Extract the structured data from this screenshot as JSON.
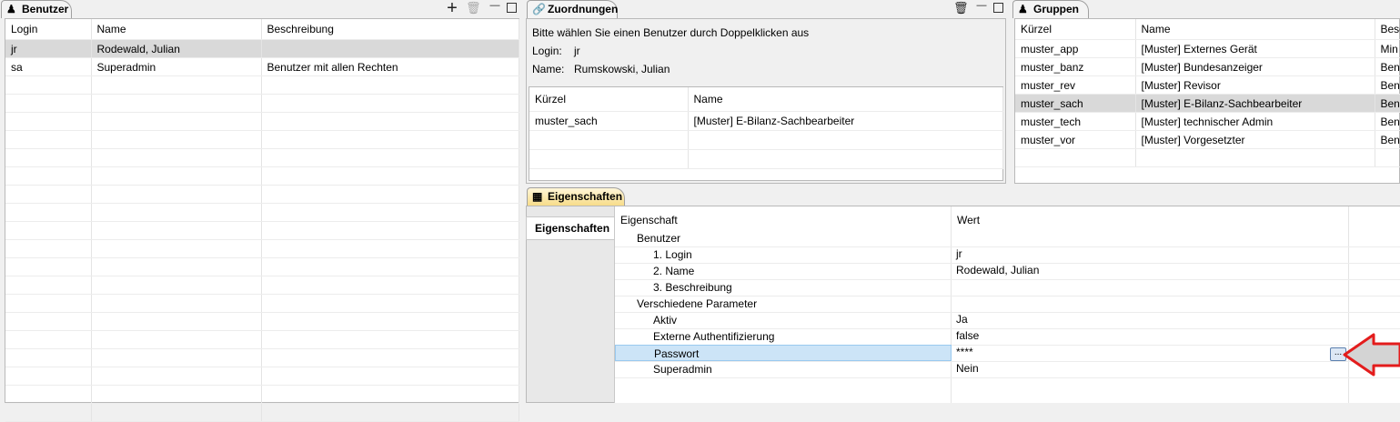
{
  "benutzer": {
    "tab_label": "Benutzer",
    "columns": [
      "Login",
      "Name",
      "Beschreibung"
    ],
    "rows": [
      {
        "login": "jr",
        "name": "Rodewald, Julian",
        "desc": ""
      },
      {
        "login": "sa",
        "name": "Superadmin",
        "desc": "Benutzer mit allen Rechten"
      }
    ]
  },
  "zuordnungen": {
    "tab_label": "Zuordnungen",
    "hint": "Bitte wählen Sie einen Benutzer durch Doppelklicken aus",
    "login_label": "Login:",
    "login_value": "jr",
    "name_label": "Name:",
    "name_value": "Rumskowski, Julian",
    "columns": [
      "Kürzel",
      "Name"
    ],
    "rows": [
      {
        "kuerzel": "muster_sach",
        "name": "[Muster] E-Bilanz-Sachbearbeiter"
      }
    ]
  },
  "gruppen": {
    "tab_label": "Gruppen",
    "columns": [
      "Kürzel",
      "Name",
      "Besc"
    ],
    "rows": [
      {
        "kuerzel": "muster_app",
        "name": "[Muster] Externes Gerät",
        "desc": "Min"
      },
      {
        "kuerzel": "muster_banz",
        "name": "[Muster] Bundesanzeiger",
        "desc": "Ben"
      },
      {
        "kuerzel": "muster_rev",
        "name": "[Muster] Revisor",
        "desc": "Ben"
      },
      {
        "kuerzel": "muster_sach",
        "name": "[Muster] E-Bilanz-Sachbearbeiter",
        "desc": "Ben"
      },
      {
        "kuerzel": "muster_tech",
        "name": "[Muster] technischer Admin",
        "desc": "Ben"
      },
      {
        "kuerzel": "muster_vor",
        "name": "[Muster] Vorgesetzter",
        "desc": "Ben"
      }
    ],
    "selected_index": 3
  },
  "eigenschaften": {
    "tab_label": "Eigenschaften",
    "side_tab_label": "Eigenschaften",
    "col_property": "Eigenschaft",
    "col_value": "Wert",
    "rows": [
      {
        "label": "Benutzer",
        "value": "",
        "indent": 1
      },
      {
        "label": "1. Login",
        "value": "jr",
        "indent": 2
      },
      {
        "label": "2. Name",
        "value": "Rodewald, Julian",
        "indent": 2
      },
      {
        "label": "3. Beschreibung",
        "value": "",
        "indent": 2
      },
      {
        "label": "Verschiedene Parameter",
        "value": "",
        "indent": 1
      },
      {
        "label": "Aktiv",
        "value": "Ja",
        "indent": 2
      },
      {
        "label": "Externe Authentifizierung",
        "value": "false",
        "indent": 2
      },
      {
        "label": "Passwort",
        "value": "****",
        "indent": 2
      },
      {
        "label": "Superadmin",
        "value": "Nein",
        "indent": 2
      }
    ],
    "selected_row": 7,
    "edit_button_label": "..."
  },
  "colors": {
    "selection_grey": "#d9d9d9",
    "selection_blue": "#cce4f7",
    "arrow_red": "#e31c1c",
    "active_tab": "#f7dc8a"
  }
}
